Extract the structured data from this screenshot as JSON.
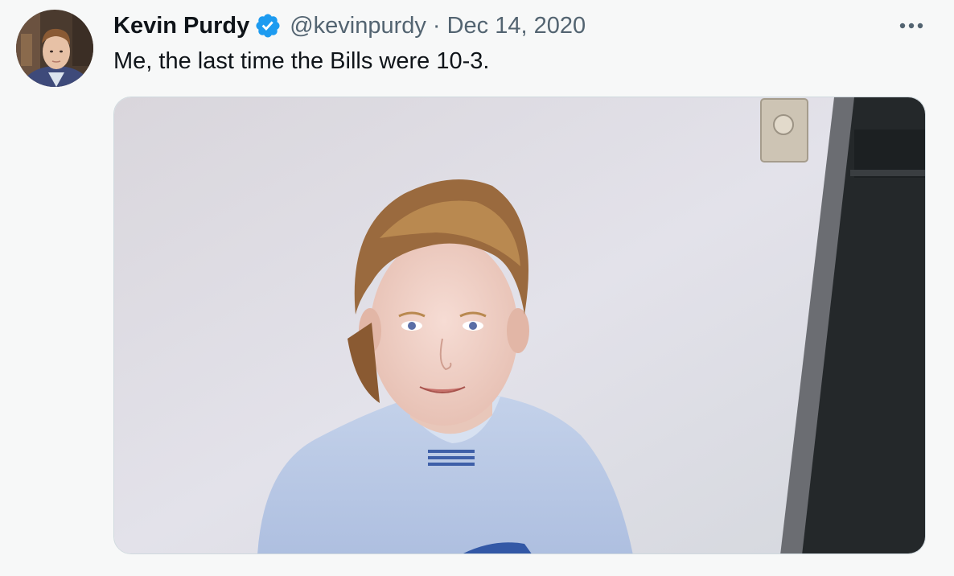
{
  "tweet": {
    "author_name": "Kevin Purdy",
    "handle": "@kevinpurdy",
    "separator": "·",
    "date": "Dec 14, 2020",
    "text": "Me, the last time the Bills were 10-3."
  },
  "icons": {
    "verified": "verified-badge-icon",
    "more": "more-options-icon"
  },
  "colors": {
    "background": "#f7f8f8",
    "text_primary": "#0f1419",
    "text_secondary": "#536471",
    "verified_blue": "#1d9bf0"
  }
}
